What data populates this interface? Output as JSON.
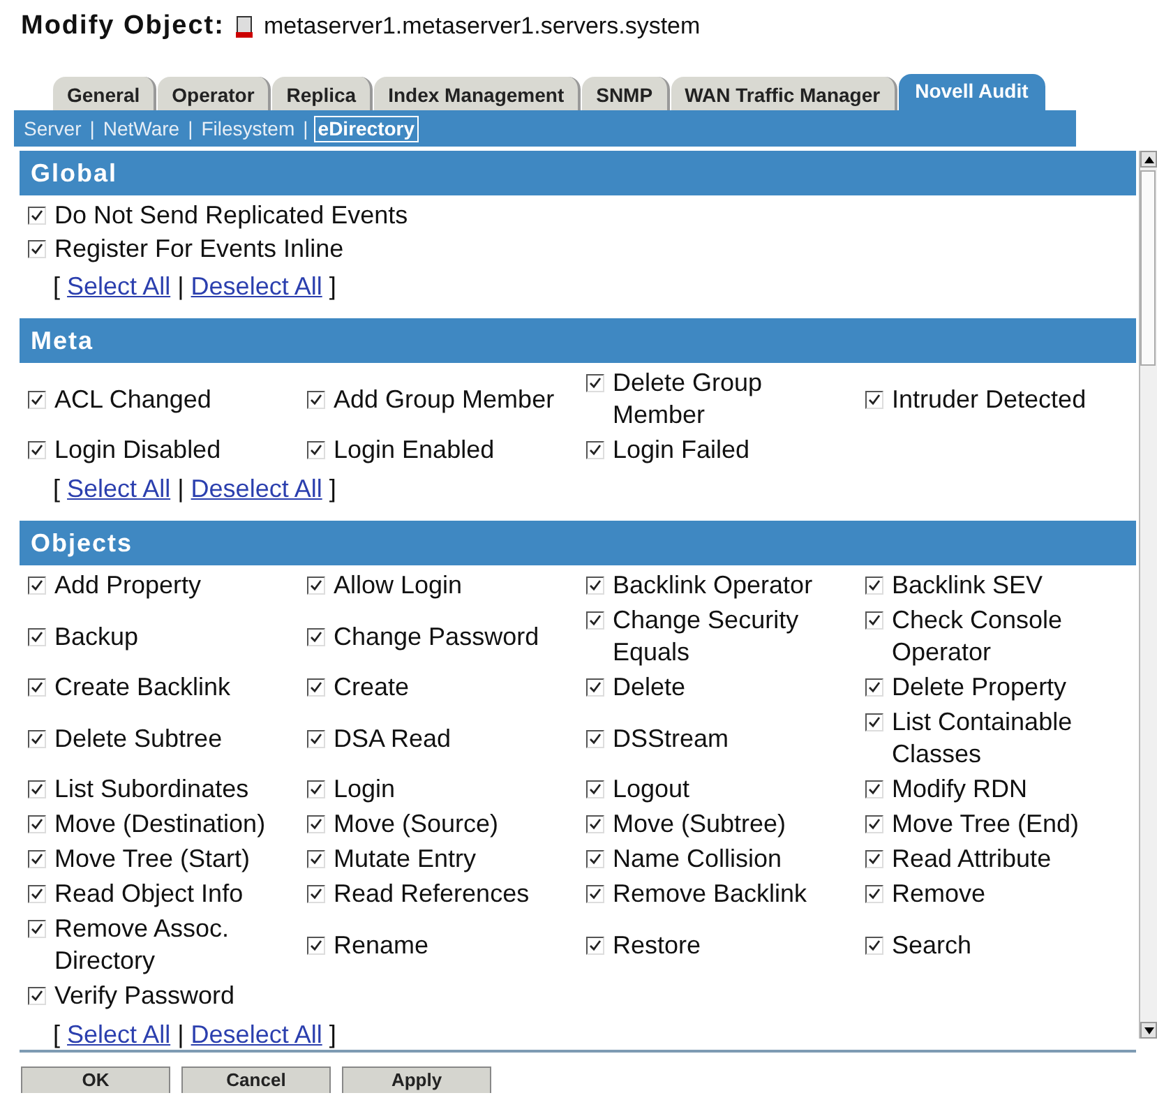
{
  "header": {
    "label": "Modify Object:",
    "object": "metaserver1.metaserver1.servers.system"
  },
  "tabs": [
    {
      "label": "General",
      "selected": false
    },
    {
      "label": "Operator",
      "selected": false
    },
    {
      "label": "Replica",
      "selected": false
    },
    {
      "label": "Index Management",
      "selected": false
    },
    {
      "label": "SNMP",
      "selected": false
    },
    {
      "label": "WAN Traffic Manager",
      "selected": false
    },
    {
      "label": "Novell Audit",
      "selected": true
    }
  ],
  "subtabs": [
    {
      "label": "Server",
      "selected": false
    },
    {
      "label": "NetWare",
      "selected": false
    },
    {
      "label": "Filesystem",
      "selected": false
    },
    {
      "label": "eDirectory",
      "selected": true
    }
  ],
  "subtab_separator": "|",
  "sections": [
    {
      "title": "Global",
      "kind": "list",
      "items": [
        {
          "label": "Do Not Send Replicated Events",
          "checked": true
        },
        {
          "label": "Register For Events Inline",
          "checked": true
        }
      ],
      "links": {
        "open": "[",
        "select_all": "Select All",
        "separator": "|",
        "deselect_all": "Deselect All",
        "close": "]"
      }
    },
    {
      "title": "Meta",
      "kind": "grid",
      "items": [
        {
          "label": "ACL Changed",
          "checked": true
        },
        {
          "label": "Add Group Member",
          "checked": true
        },
        {
          "label": "Delete Group Member",
          "checked": true
        },
        {
          "label": "Intruder Detected",
          "checked": true
        },
        {
          "label": "Login Disabled",
          "checked": true
        },
        {
          "label": "Login Enabled",
          "checked": true
        },
        {
          "label": "Login Failed",
          "checked": true
        }
      ],
      "links": {
        "open": "[",
        "select_all": "Select All",
        "separator": "|",
        "deselect_all": "Deselect All",
        "close": "]"
      }
    },
    {
      "title": "Objects",
      "kind": "grid",
      "items": [
        {
          "label": "Add Property",
          "checked": true
        },
        {
          "label": "Allow Login",
          "checked": true
        },
        {
          "label": "Backlink Operator",
          "checked": true
        },
        {
          "label": "Backlink SEV",
          "checked": true
        },
        {
          "label": "Backup",
          "checked": true
        },
        {
          "label": "Change Password",
          "checked": true
        },
        {
          "label": "Change Security Equals",
          "checked": true
        },
        {
          "label": "Check Console Operator",
          "checked": true
        },
        {
          "label": "Create Backlink",
          "checked": true
        },
        {
          "label": "Create",
          "checked": true
        },
        {
          "label": "Delete",
          "checked": true
        },
        {
          "label": "Delete Property",
          "checked": true
        },
        {
          "label": "Delete Subtree",
          "checked": true
        },
        {
          "label": "DSA Read",
          "checked": true
        },
        {
          "label": "DSStream",
          "checked": true
        },
        {
          "label": "List Containable Classes",
          "checked": true
        },
        {
          "label": "List Subordinates",
          "checked": true
        },
        {
          "label": "Login",
          "checked": true
        },
        {
          "label": "Logout",
          "checked": true
        },
        {
          "label": "Modify RDN",
          "checked": true
        },
        {
          "label": "Move (Destination)",
          "checked": true
        },
        {
          "label": "Move (Source)",
          "checked": true
        },
        {
          "label": "Move (Subtree)",
          "checked": true
        },
        {
          "label": "Move Tree (End)",
          "checked": true
        },
        {
          "label": "Move Tree (Start)",
          "checked": true
        },
        {
          "label": "Mutate Entry",
          "checked": true
        },
        {
          "label": "Name Collision",
          "checked": true
        },
        {
          "label": "Read Attribute",
          "checked": true
        },
        {
          "label": "Read Object Info",
          "checked": true
        },
        {
          "label": "Read References",
          "checked": true
        },
        {
          "label": "Remove Backlink",
          "checked": true
        },
        {
          "label": "Remove",
          "checked": true
        },
        {
          "label": "Remove Assoc. Directory",
          "checked": true
        },
        {
          "label": "Rename",
          "checked": true
        },
        {
          "label": "Restore",
          "checked": true
        },
        {
          "label": "Search",
          "checked": true
        },
        {
          "label": "Verify Password",
          "checked": true
        }
      ],
      "links": {
        "open": "[",
        "select_all": "Select All",
        "separator": "|",
        "deselect_all": "Deselect All",
        "close": "]"
      }
    }
  ],
  "buttons": [
    "OK",
    "Cancel",
    "Apply"
  ]
}
